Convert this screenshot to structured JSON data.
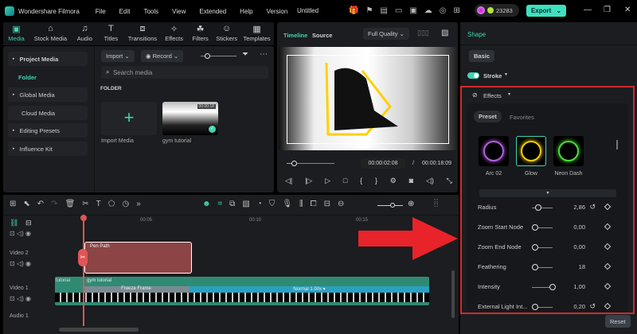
{
  "app": {
    "name": "Wondershare Filmora",
    "doc_title": "Untitled",
    "menu": [
      "File",
      "Edit",
      "Tools",
      "View",
      "Extended",
      "Help",
      "Version"
    ],
    "credits": "23283",
    "export_label": "Export"
  },
  "media_tabs": [
    "Media",
    "Stock Media",
    "Audio",
    "Titles",
    "Transitions",
    "Effects",
    "Filters",
    "Stickers",
    "Templates"
  ],
  "sidebar": {
    "items": [
      "Project Media",
      "Folder",
      "Global Media",
      "Cloud Media",
      "Editing Presets",
      "Influence Kit"
    ]
  },
  "media": {
    "import_label": "Import",
    "record_label": "Record",
    "search_placeholder": "Search media",
    "folder_heading": "FOLDER",
    "import_media_label": "Import Media",
    "clip_name": "gym tutorial",
    "clip_duration": "00:00:18"
  },
  "preview": {
    "tabs": [
      "Timeline",
      "Source"
    ],
    "quality": "Full Quality",
    "current_time": "00:00:02:08",
    "separator": "/",
    "total_time": "00:00:18:09",
    "progress": 0.13
  },
  "right": {
    "title": "Shape",
    "basic_tab": "Basic",
    "stroke_label": "Stroke",
    "stroke_on": true,
    "effects_label": "Effects",
    "preset_tab": "Preset",
    "favorites_tab": "Favorites",
    "presets": [
      {
        "name": "Arc 02",
        "color": "#b05ee0"
      },
      {
        "name": "Glow",
        "color": "#f5d000"
      },
      {
        "name": "Neon Dash",
        "color": "#4cdc3a"
      }
    ],
    "params": [
      {
        "label": "Radius",
        "value": "2,86",
        "level": 0.2,
        "reset": true
      },
      {
        "label": "Zoom Start Node",
        "value": "0,00",
        "level": 0,
        "reset": false
      },
      {
        "label": "Zoom End Node",
        "value": "0,00",
        "level": 0,
        "reset": false
      },
      {
        "label": "Feathering",
        "value": "18",
        "level": 0,
        "reset": false
      },
      {
        "label": "Intensity",
        "value": "1,00",
        "level": 1,
        "reset": false
      },
      {
        "label": "External Light Int...",
        "value": "0,20",
        "level": 0,
        "reset": true
      }
    ],
    "reset_label": "Reset"
  },
  "timeline": {
    "ticks": [
      "00:05",
      "00:10",
      "00:15"
    ],
    "tracks": [
      "Video 2",
      "Video 1",
      "Audio 1"
    ],
    "pen_clip": "Pen Path",
    "video_clip": "gym tutorial",
    "prev_clip": "tutorial",
    "freeze_label": "Freeze Frame",
    "speed_label": "Normal 1.00x"
  }
}
